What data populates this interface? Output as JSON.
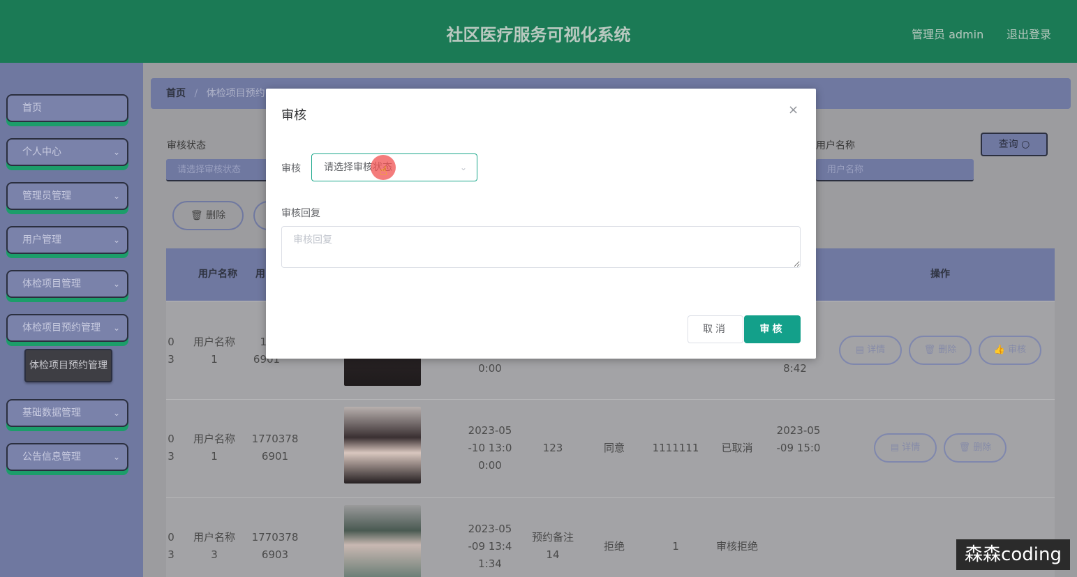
{
  "header": {
    "title": "社区医疗服务可视化系统",
    "admin": "管理员 admin",
    "logout": "退出登录"
  },
  "sidebar": {
    "items": [
      {
        "label": "首页",
        "has_chevron": false
      },
      {
        "label": "个人中心",
        "has_chevron": true
      },
      {
        "label": "管理员管理",
        "has_chevron": true
      },
      {
        "label": "用户管理",
        "has_chevron": true
      },
      {
        "label": "体检项目管理",
        "has_chevron": true
      },
      {
        "label": "体检项目预约管理",
        "has_chevron": true
      },
      {
        "label": "基础数据管理",
        "has_chevron": true
      },
      {
        "label": "公告信息管理",
        "has_chevron": true
      }
    ],
    "sub_item": "体检项目预约管理",
    "chevron": "⌄"
  },
  "breadcrumb": {
    "home": "首页",
    "sep": "/",
    "current": "体检项目预约"
  },
  "filters": {
    "status_label": "审核状态",
    "status_placeholder": "请选择审核状态",
    "user_label": "用户名称",
    "user_placeholder": "用户名称",
    "query_label": "查询"
  },
  "actions": {
    "delete_label": "删除"
  },
  "table": {
    "headers": {
      "username": "用户名称",
      "phone": "用",
      "ops": "操作"
    },
    "rows": [
      {
        "id_a": "0",
        "id_b": "3",
        "user_a": "用户名称",
        "user_b": "1",
        "phone_a": "17",
        "phone_b": "6901",
        "time": "0:00",
        "created": "8:42",
        "ops": [
          "详情",
          "删除",
          "审核"
        ]
      },
      {
        "id_a": "0",
        "id_b": "3",
        "user_a": "用户名称",
        "user_b": "1",
        "phone_a": "1770378",
        "phone_b": "6901",
        "time_a": "2023-05",
        "time_b": "-10 13:0",
        "time_c": "0:00",
        "remark": "123",
        "agree": "同意",
        "code": "1111111",
        "status": "已取消",
        "created_a": "2023-05",
        "created_b": "-09 15:0",
        "ops": [
          "详情",
          "删除"
        ]
      },
      {
        "id_a": "0",
        "id_b": "3",
        "user_a": "用户名称",
        "user_b": "3",
        "phone_a": "1770378",
        "phone_b": "6903",
        "time_a": "2023-05",
        "time_b": "-09 13:4",
        "time_c": "1:34",
        "remark_a": "预约备注",
        "remark_b": "14",
        "agree": "拒绝",
        "code": "1",
        "status": "审核拒绝"
      }
    ]
  },
  "modal": {
    "title": "审核",
    "close": "×",
    "audit_label": "审核",
    "audit_placeholder": "请选择审核状态",
    "reply_label": "审核回复",
    "reply_placeholder": "审核回复",
    "cancel": "取消",
    "confirm": "审核"
  },
  "watermark": "森森coding",
  "colors": {
    "header_bg": "#1b7a55",
    "sidebar_bg": "#6f78a0",
    "primary": "#13a08a"
  }
}
